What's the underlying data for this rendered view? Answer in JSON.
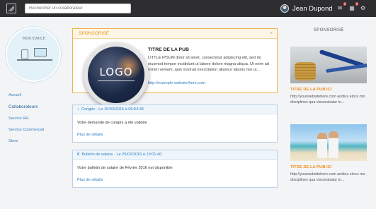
{
  "topbar": {
    "search_placeholder": "Rechercher un collaborateur",
    "user_name": "Jean Dupond",
    "notif_count_1": "2",
    "notif_count_2": "3"
  },
  "sidebar": {
    "profile_label": "MON EVRICE",
    "items": [
      {
        "label": "Accueil"
      },
      {
        "label": "Collaborateurs"
      },
      {
        "label": "Service RH"
      },
      {
        "label": "Service Commercial"
      },
      {
        "label": "Store"
      }
    ]
  },
  "sponsored": {
    "header": "SPONSORISÉ",
    "logo_text": "LOGO",
    "title": "TITRE DE LA PUB",
    "body": "LITTLE IPSUM dolor sit amet, consectetur adipiscing elit, sed do eiusmod tempor incididunt ut labore dolore magna aliqua. Ut enim ad minim veniam, quis nostrud exercitation ullamco laboris nisi ut...",
    "link": "http://example-website/here.com"
  },
  "notifications": [
    {
      "header": "Congés - Le 15/03/2016 à 06:54:36",
      "text": "Votre demande de congés a été validée",
      "link": "Plus de détails"
    },
    {
      "header": "Bulletin de salaire - Le 25/02/2016 à 19:01:46",
      "text": "Votre bulletin de salaire de Février 2016 est disponible",
      "link": "Plus de détails"
    }
  ],
  "right": {
    "header": "SPONSORISÉ",
    "ads": [
      {
        "title": "TITRE DE LA PUB ICI",
        "body": "http://yourwebsitehere.com andius elocu mo disciplines qua viscerabatur in..."
      },
      {
        "title": "TITRE DE LA PUB ICI",
        "body": "http://yourwebsitehere.com andius elocu mo disciplines qua viscerabatur in..."
      }
    ]
  }
}
